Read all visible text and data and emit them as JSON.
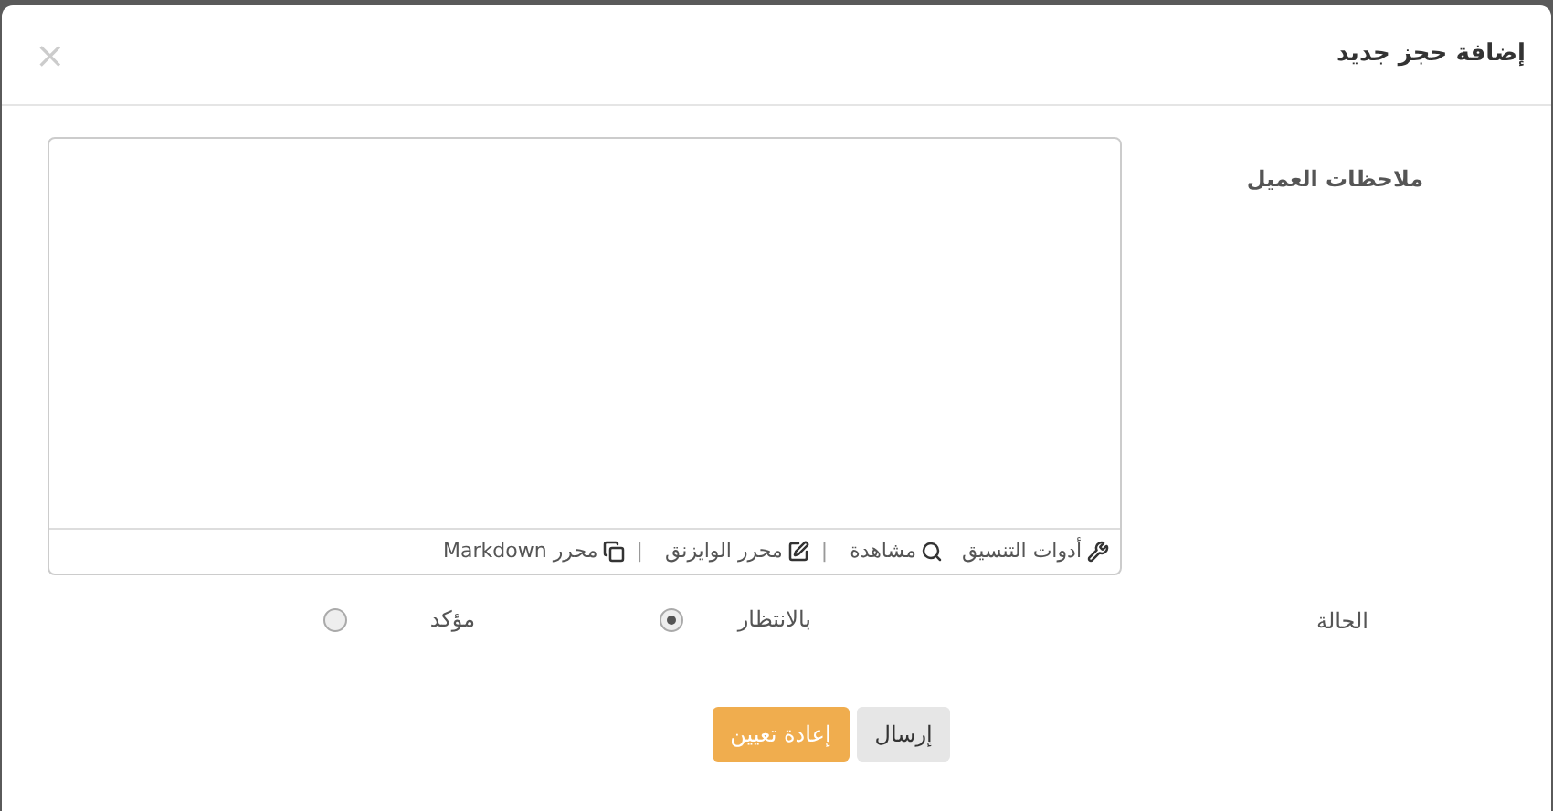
{
  "dialog": {
    "title": "إضافة حجز جديد",
    "close": "×"
  },
  "notes": {
    "label": "ملاحظات العميل",
    "toolbar": [
      {
        "kind": "tools",
        "label": "أدوات التنسيق"
      },
      {
        "kind": "preview",
        "label": "مشاهدة"
      },
      {
        "kind": "wysiwyg",
        "label": "محرر الوايزنق",
        "separator": "|"
      },
      {
        "kind": "markdown",
        "label": "محرر Markdown",
        "separator": "|"
      }
    ]
  },
  "status": {
    "label": "الحالة",
    "options": [
      {
        "label": "بالانتظار",
        "selected": true
      },
      {
        "label": "مؤكد",
        "selected": false
      }
    ]
  },
  "buttons": [
    {
      "kind": "default",
      "label": "إرسال"
    },
    {
      "kind": "primary",
      "label": "إعادة تعيين"
    }
  ]
}
